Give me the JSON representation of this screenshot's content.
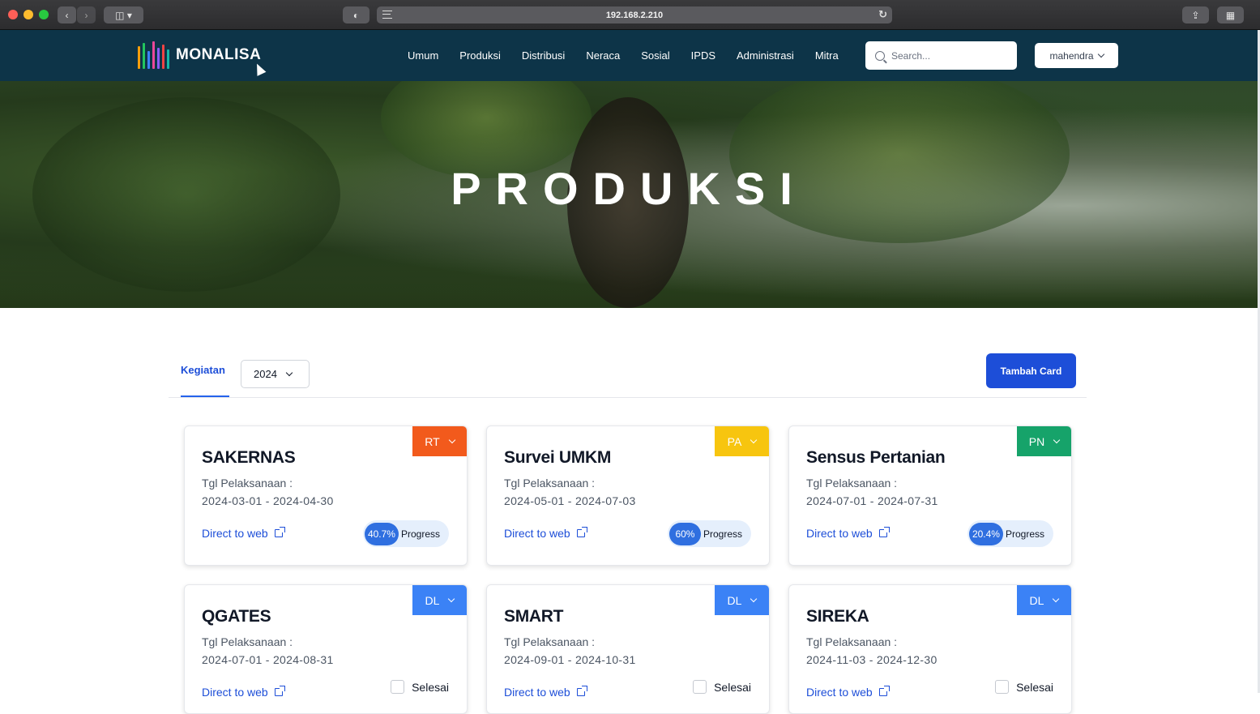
{
  "browser": {
    "url": "192.168.2.210"
  },
  "navbar": {
    "logo_text": "MONALISA",
    "logo_bar_colors": [
      "#f59e0b",
      "#22c55e",
      "#3b82f6",
      "#ec4899",
      "#8b5cf6",
      "#ef4444",
      "#14b8a6"
    ],
    "menu": [
      "Umum",
      "Produksi",
      "Distribusi",
      "Neraca",
      "Sosial",
      "IPDS",
      "Administrasi",
      "Mitra"
    ],
    "search_placeholder": "Search...",
    "user": "mahendra"
  },
  "hero": {
    "title": "PRODUKSI"
  },
  "toolbar": {
    "tab": "Kegiatan",
    "year": "2024",
    "add_button": "Tambah Card"
  },
  "cards": [
    {
      "title": "SAKERNAS",
      "tag": "RT",
      "tag_color": "#f25a1c",
      "label": "Tgl Pelaksanaan :",
      "dates": "2024-03-01 - 2024-04-30",
      "link": "Direct to web",
      "progress": "40.7%",
      "progress_label": "Progress"
    },
    {
      "title": "Survei UMKM",
      "tag": "PA",
      "tag_color": "#f7c50f",
      "label": "Tgl Pelaksanaan :",
      "dates": "2024-05-01 - 2024-07-03",
      "link": "Direct to web",
      "progress": "60%",
      "progress_label": "Progress"
    },
    {
      "title": "Sensus Pertanian",
      "tag": "PN",
      "tag_color": "#16a36a",
      "label": "Tgl Pelaksanaan :",
      "dates": "2024-07-01 - 2024-07-31",
      "link": "Direct to web",
      "progress": "20.4%",
      "progress_label": "Progress"
    },
    {
      "title": "QGATES",
      "tag": "DL",
      "tag_color": "#3b82f6",
      "label": "Tgl Pelaksanaan :",
      "dates": "2024-07-01 - 2024-08-31",
      "link": "Direct to web",
      "status": "Selesai"
    },
    {
      "title": "SMART",
      "tag": "DL",
      "tag_color": "#3b82f6",
      "label": "Tgl Pelaksanaan :",
      "dates": "2024-09-01 - 2024-10-31",
      "link": "Direct to web",
      "status": "Selesai"
    },
    {
      "title": "SIREKA",
      "tag": "DL",
      "tag_color": "#3b82f6",
      "label": "Tgl Pelaksanaan :",
      "dates": "2024-11-03 - 2024-12-30",
      "link": "Direct to web",
      "status": "Selesai"
    }
  ]
}
